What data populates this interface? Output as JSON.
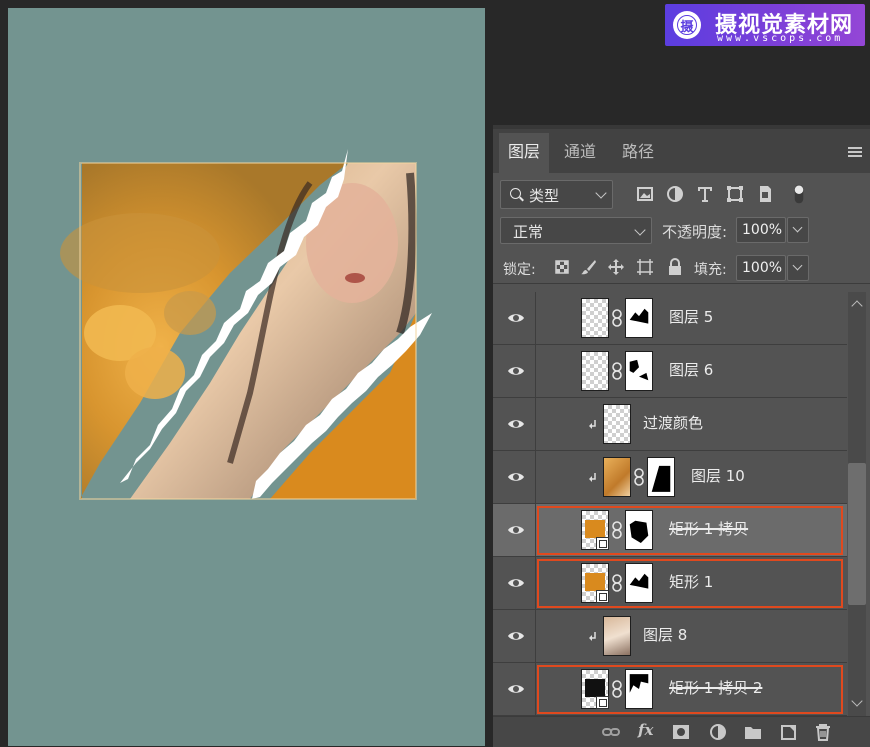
{
  "watermark": {
    "title": "摄视觉素材网",
    "url": "www.vscops.com",
    "badge": "摄"
  },
  "panel": {
    "tabs": [
      {
        "label": "图层",
        "active": true
      },
      {
        "label": "通道",
        "active": false
      },
      {
        "label": "路径",
        "active": false
      }
    ],
    "filter": {
      "label": "类型",
      "icons": [
        "image-filter-icon",
        "adjustment-filter-icon",
        "type-filter-icon",
        "shape-filter-icon",
        "smart-object-filter-icon",
        "filter-toggle-icon"
      ]
    },
    "blend_mode": "正常",
    "opacity_label": "不透明度:",
    "opacity_value": "100%",
    "lock_label": "锁定:",
    "fill_label": "填充:",
    "fill_value": "100%"
  },
  "layers": [
    {
      "name": "图层 5",
      "visible": true,
      "clipped": false,
      "has_mask": true,
      "thumb": "transparent",
      "selected": false,
      "highlighted": false,
      "strike": false
    },
    {
      "name": "图层 6",
      "visible": true,
      "clipped": false,
      "has_mask": true,
      "thumb": "transparent",
      "selected": false,
      "highlighted": false,
      "strike": false
    },
    {
      "name": "过渡颜色",
      "visible": true,
      "clipped": true,
      "has_mask": false,
      "thumb": "transparent",
      "selected": false,
      "highlighted": false,
      "strike": false
    },
    {
      "name": "图层 10",
      "visible": true,
      "clipped": true,
      "has_mask": true,
      "thumb": "photo-rose",
      "selected": false,
      "highlighted": false,
      "strike": false
    },
    {
      "name": "矩形 1 拷贝",
      "visible": true,
      "clipped": false,
      "has_mask": true,
      "thumb": "shape-orange",
      "selected": true,
      "highlighted": true,
      "strike": true
    },
    {
      "name": "矩形 1",
      "visible": true,
      "clipped": false,
      "has_mask": true,
      "thumb": "shape-orange",
      "selected": false,
      "highlighted": true,
      "strike": false
    },
    {
      "name": "图层 8",
      "visible": true,
      "clipped": true,
      "has_mask": false,
      "thumb": "photo-woman",
      "selected": false,
      "highlighted": false,
      "strike": false
    },
    {
      "name": "矩形 1 拷贝 2",
      "visible": true,
      "clipped": false,
      "has_mask": true,
      "thumb": "shape-black",
      "selected": false,
      "highlighted": true,
      "strike": true
    }
  ],
  "bottom_bar": [
    "link-layers-icon",
    "fx-icon",
    "add-mask-icon",
    "adjustment-layer-icon",
    "new-group-icon",
    "new-layer-icon",
    "delete-layer-icon"
  ],
  "bottom_bar_fx": "fx",
  "colors": {
    "canvas_bg": "#739490",
    "orange": "#d98a1e",
    "highlight": "#e0491e",
    "panel_bg": "#535353"
  }
}
